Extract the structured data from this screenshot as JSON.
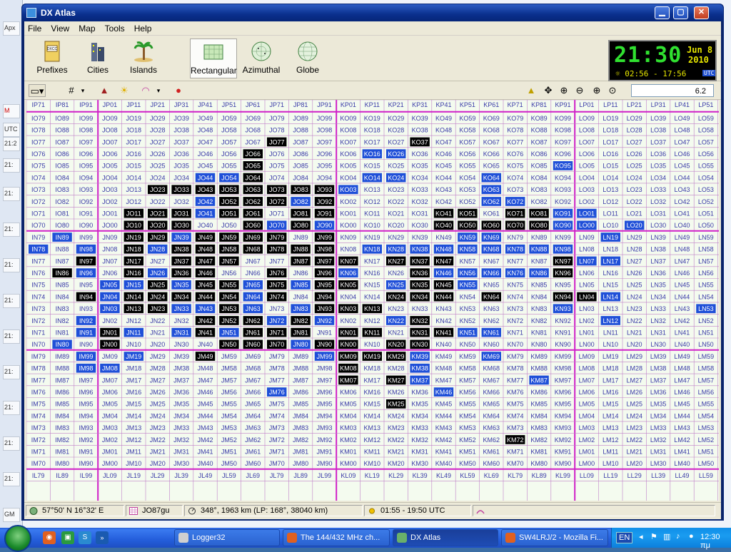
{
  "window": {
    "title": "DX Atlas",
    "controls": {
      "minimize": "▁",
      "maximize": "▢",
      "close": "✕"
    }
  },
  "menu": [
    "File",
    "View",
    "Map",
    "Tools",
    "Help"
  ],
  "toolbar": {
    "buttons": [
      {
        "label": "Prefixes",
        "icon": "prefixes-icon"
      },
      {
        "label": "Cities",
        "icon": "cities-icon"
      },
      {
        "label": "Islands",
        "icon": "islands-icon"
      },
      {
        "label": "Rectangular",
        "icon": "rectangular-icon",
        "active": true
      },
      {
        "label": "Azimuthal",
        "icon": "azimuthal-icon"
      },
      {
        "label": "Globe",
        "icon": "globe-icon"
      }
    ],
    "zoom_value": "6.2"
  },
  "clock": {
    "time": "21:30",
    "date_line1": "Jun 8",
    "date_line2": "2010",
    "sun_times": "02:56 - 17:56",
    "utc_badge": "UTC"
  },
  "map": {
    "col_fields": [
      "I",
      "I",
      "J",
      "J",
      "J",
      "J",
      "J",
      "J",
      "J",
      "J",
      "J",
      "J",
      "J",
      "K",
      "K",
      "K",
      "K",
      "K",
      "K",
      "K",
      "K",
      "K",
      "K",
      "L",
      "L",
      "L",
      "L",
      "L",
      "L",
      "L"
    ],
    "col_squares": [
      8,
      9,
      0,
      1,
      2,
      3,
      4,
      5,
      6,
      7,
      8,
      9,
      0,
      1,
      2,
      3,
      4,
      5,
      6,
      7,
      8,
      9,
      0,
      1,
      2,
      3,
      4,
      5,
      6,
      7
    ],
    "col_note": "columns IP8.. to LP6x; column letter pair field, second char field row",
    "top_row_labels": [
      "IP71",
      "IP81",
      "IP91",
      "JP01",
      "JP11",
      "JP21",
      "JP31",
      "JP41",
      "JP51",
      "JP61",
      "JP71",
      "JP81",
      "JP91",
      "KP01",
      "KP11",
      "KP21",
      "KP31",
      "KP41",
      "KP51",
      "KP61",
      "KP71",
      "KP81",
      "KP91",
      "LP01",
      "LP11",
      "LP21",
      "LP31",
      "LP41",
      "LP51"
    ],
    "bottom_row_labels": [
      "IL79",
      "IL89",
      "IL99",
      "JL09",
      "JL19",
      "JL29",
      "JL39",
      "JL49",
      "JL59",
      "JL69",
      "JL79",
      "JL89",
      "JL99",
      "KL09",
      "KL19",
      "KL29",
      "KL39",
      "KL49",
      "KL59",
      "KL69",
      "KL79",
      "KL89",
      "KL99",
      "LL09",
      "LL19",
      "LL29",
      "LL39",
      "LL49",
      "LL59"
    ],
    "highlight_black": [
      "JO77",
      "JO66",
      "JO65",
      "JO64",
      "JO23",
      "JO33",
      "JO43",
      "JO53",
      "JO63",
      "JO73",
      "JO83",
      "JO93",
      "JO52",
      "JO62",
      "JO72",
      "JO92",
      "JO11",
      "JO21",
      "JO31",
      "JO51",
      "JO61",
      "JO81",
      "JO91",
      "JO10",
      "JO20",
      "JO30",
      "JO60",
      "JO80",
      "JN19",
      "JN29",
      "JN49",
      "JN59",
      "JN69",
      "JN79",
      "JN99",
      "JN18",
      "JN38",
      "JN48",
      "JN58",
      "JN68",
      "JN78",
      "JN88",
      "JN98",
      "IN97",
      "JN17",
      "JN37",
      "JN47",
      "JN57",
      "JN87",
      "JN97",
      "IN86",
      "JN16",
      "JN36",
      "JN46",
      "JN76",
      "JN96",
      "JN25",
      "JN45",
      "JN55",
      "JN75",
      "JN95",
      "IN94",
      "JN14",
      "JN24",
      "JN34",
      "JN44",
      "JN54",
      "JN74",
      "JN94",
      "JN13",
      "JN23",
      "JN53",
      "JN93",
      "JN42",
      "JN52",
      "JN62",
      "JN82",
      "JN01",
      "JN41",
      "JN61",
      "JN71",
      "JN81",
      "JN00",
      "JN50",
      "JN60",
      "JN70",
      "JN90",
      "JM49",
      "KO37",
      "KO41",
      "KO51",
      "KO71",
      "KO81",
      "KO40",
      "KO50",
      "KO60",
      "KO70",
      "KO80",
      "KN07",
      "KN27",
      "KN37",
      "KN47",
      "KN97",
      "KN36",
      "KN96",
      "KN05",
      "KN35",
      "KN45",
      "KN24",
      "KN34",
      "KN44",
      "KN64",
      "KN94",
      "LN04",
      "KN03",
      "KN13",
      "KN32",
      "KN01",
      "KN11",
      "KN31",
      "KN41",
      "KN00",
      "KN20",
      "KN30",
      "KM09",
      "KM19",
      "KM29",
      "KM08",
      "KM07",
      "KM27",
      "KM25",
      "KM72"
    ],
    "highlight_blue": [
      "KO16",
      "KO26",
      "JO44",
      "JO54",
      "KO14",
      "KO24",
      "KO64",
      "KO03",
      "KO63",
      "KO95",
      "JO42",
      "JO82",
      "KO72",
      "JO41",
      "JO70",
      "JO90",
      "KO91",
      "LO01",
      "KO62",
      "LO00",
      "KO90",
      "LO20",
      "IN89",
      "JN39",
      "IN78",
      "IN98",
      "JN28",
      "KN38",
      "KN58",
      "KN88",
      "KN98",
      "KN18",
      "KN28",
      "KN48",
      "KN78",
      "KN68",
      "KN86",
      "LN07",
      "LN17",
      "IN96",
      "JN26",
      "KN06",
      "KN46",
      "KN56",
      "KN66",
      "KN76",
      "KN86",
      "JN05",
      "JN15",
      "JN35",
      "JN65",
      "JN85",
      "KN25",
      "KN55",
      "JN04",
      "JN64",
      "LN14",
      "JN03",
      "JN33",
      "JN43",
      "JN63",
      "JN83",
      "KN93",
      "LN53",
      "IN92",
      "JN72",
      "JN92",
      "KN22",
      "LN12",
      "IN91",
      "JN11",
      "JN31",
      "JN51",
      "KN61",
      "KN51",
      "IN80",
      "JN80",
      "KM39",
      "IM99",
      "JM19",
      "JM99",
      "KM69",
      "IM98",
      "JM08",
      "KM38",
      "KM87",
      "KM37",
      "JM76",
      "KM46",
      "KN59",
      "KN69",
      "LN19"
    ]
  },
  "status": {
    "coords": "57°50' N  16°32' E",
    "locator": "JO87gu",
    "bearing": "348°, 1963 km  (LP: 168°, 38040 km)",
    "sun": "01:55 - 19:50 UTC"
  },
  "taskbar": {
    "tasks": [
      {
        "label": "Logger32",
        "icon": "logger-icon"
      },
      {
        "label": "The 144/432 MHz ch...",
        "icon": "firefox-icon"
      },
      {
        "label": "DX Atlas",
        "icon": "dxatlas-icon",
        "active": true
      },
      {
        "label": "SW4LRJ/2 - Mozilla Fi...",
        "icon": "firefox-icon"
      }
    ],
    "tray": {
      "lang": "EN",
      "time": "12:30 πμ"
    }
  },
  "background_app": {
    "labels": [
      "Apx",
      "M",
      "UTC",
      "21:2",
      "21:",
      "21:",
      "21:",
      "21:",
      "21:",
      "21:",
      "21:",
      "21:",
      "21:",
      "21:",
      "21:",
      "GM"
    ]
  }
}
